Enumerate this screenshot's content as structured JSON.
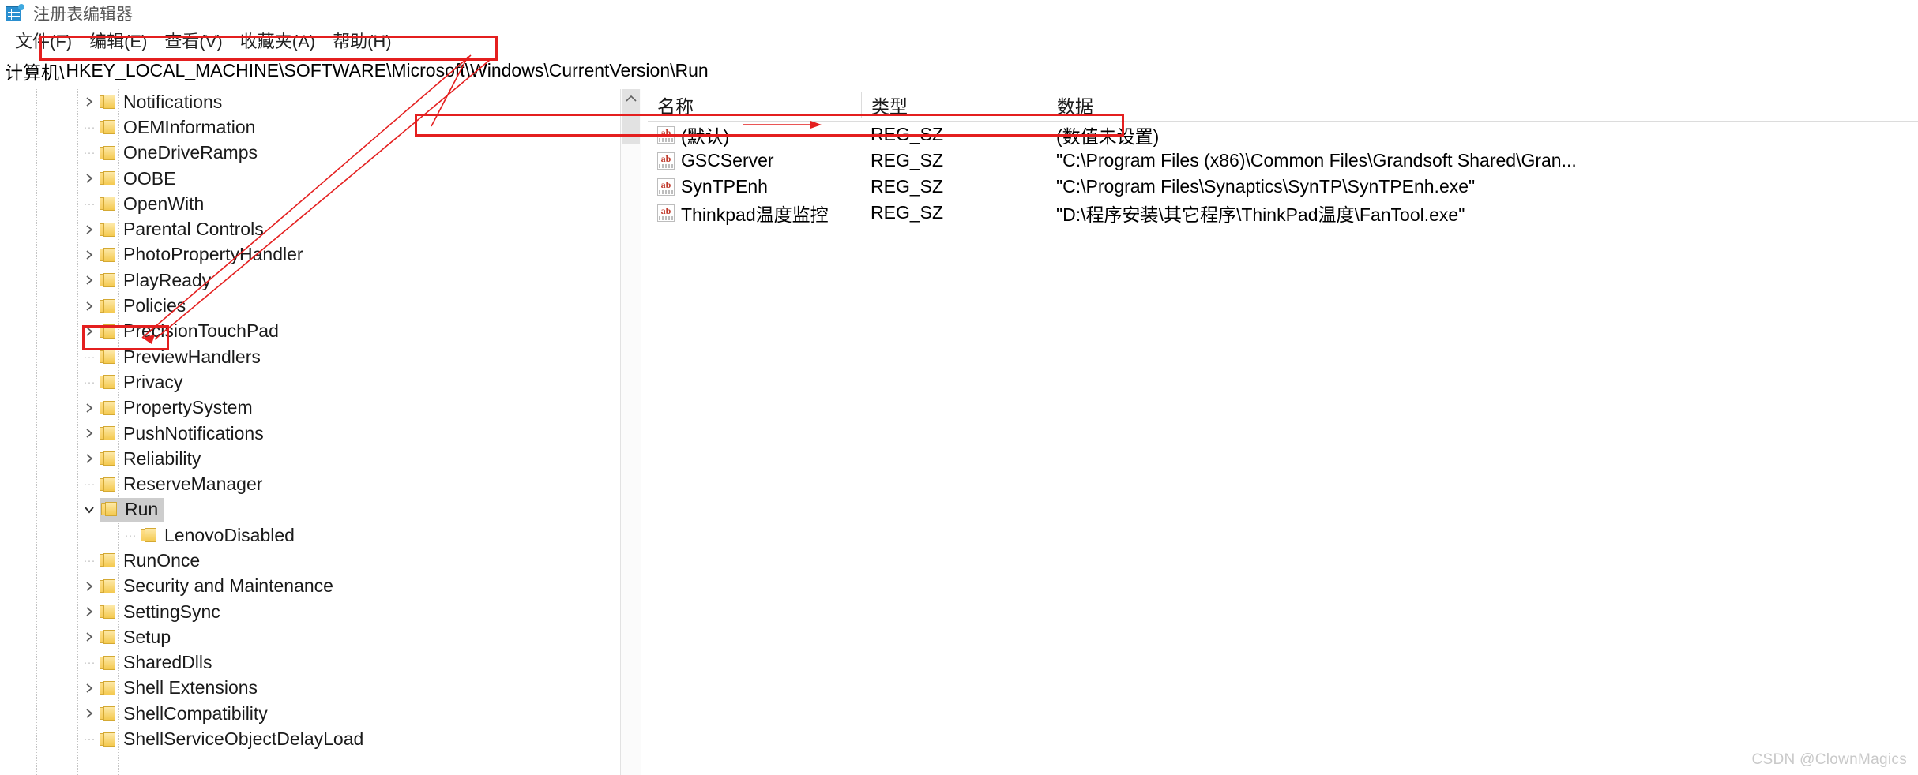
{
  "window": {
    "title": "注册表编辑器",
    "icon": "registry-editor-icon"
  },
  "menu": {
    "items": [
      {
        "label": "文件(F)"
      },
      {
        "label": "编辑(E)"
      },
      {
        "label": "查看(V)"
      },
      {
        "label": "收藏夹(A)"
      },
      {
        "label": "帮助(H)"
      }
    ]
  },
  "address": {
    "prefix": "计算机\\",
    "value": "HKEY_LOCAL_MACHINE\\SOFTWARE\\Microsoft\\Windows\\CurrentVersion\\Run"
  },
  "tree": {
    "scroll_up_icon": "chevron-up-icon",
    "items": [
      {
        "label": "Notifications",
        "depth": 1,
        "expander": "collapsed",
        "selected": false
      },
      {
        "label": "OEMInformation",
        "depth": 1,
        "expander": "leaf",
        "selected": false
      },
      {
        "label": "OneDriveRamps",
        "depth": 1,
        "expander": "leaf",
        "selected": false
      },
      {
        "label": "OOBE",
        "depth": 1,
        "expander": "collapsed",
        "selected": false
      },
      {
        "label": "OpenWith",
        "depth": 1,
        "expander": "leaf",
        "selected": false
      },
      {
        "label": "Parental Controls",
        "depth": 1,
        "expander": "collapsed",
        "selected": false
      },
      {
        "label": "PhotoPropertyHandler",
        "depth": 1,
        "expander": "collapsed",
        "selected": false
      },
      {
        "label": "PlayReady",
        "depth": 1,
        "expander": "collapsed",
        "selected": false
      },
      {
        "label": "Policies",
        "depth": 1,
        "expander": "collapsed",
        "selected": false
      },
      {
        "label": "PrecisionTouchPad",
        "depth": 1,
        "expander": "collapsed",
        "selected": false
      },
      {
        "label": "PreviewHandlers",
        "depth": 1,
        "expander": "leaf",
        "selected": false
      },
      {
        "label": "Privacy",
        "depth": 1,
        "expander": "leaf",
        "selected": false
      },
      {
        "label": "PropertySystem",
        "depth": 1,
        "expander": "collapsed",
        "selected": false
      },
      {
        "label": "PushNotifications",
        "depth": 1,
        "expander": "collapsed",
        "selected": false
      },
      {
        "label": "Reliability",
        "depth": 1,
        "expander": "collapsed",
        "selected": false
      },
      {
        "label": "ReserveManager",
        "depth": 1,
        "expander": "leaf",
        "selected": false
      },
      {
        "label": "Run",
        "depth": 1,
        "expander": "expanded",
        "selected": true
      },
      {
        "label": "LenovoDisabled",
        "depth": 2,
        "expander": "leaf",
        "selected": false
      },
      {
        "label": "RunOnce",
        "depth": 1,
        "expander": "leaf",
        "selected": false
      },
      {
        "label": "Security and Maintenance",
        "depth": 1,
        "expander": "collapsed",
        "selected": false
      },
      {
        "label": "SettingSync",
        "depth": 1,
        "expander": "collapsed",
        "selected": false
      },
      {
        "label": "Setup",
        "depth": 1,
        "expander": "collapsed",
        "selected": false
      },
      {
        "label": "SharedDlls",
        "depth": 1,
        "expander": "leaf",
        "selected": false
      },
      {
        "label": "Shell Extensions",
        "depth": 1,
        "expander": "collapsed",
        "selected": false
      },
      {
        "label": "ShellCompatibility",
        "depth": 1,
        "expander": "collapsed",
        "selected": false
      },
      {
        "label": "ShellServiceObjectDelayLoad",
        "depth": 1,
        "expander": "leaf",
        "selected": false
      }
    ]
  },
  "list": {
    "columns": [
      {
        "key": "name",
        "label": "名称"
      },
      {
        "key": "type",
        "label": "类型"
      },
      {
        "key": "data",
        "label": "数据"
      }
    ],
    "rows": [
      {
        "icon": "string-value-icon",
        "name": "(默认)",
        "type": "REG_SZ",
        "data": "(数值未设置)"
      },
      {
        "icon": "string-value-icon",
        "name": "GSCServer",
        "type": "REG_SZ",
        "data": "\"C:\\Program Files (x86)\\Common Files\\Grandsoft Shared\\Gran..."
      },
      {
        "icon": "string-value-icon",
        "name": "SynTPEnh",
        "type": "REG_SZ",
        "data": "\"C:\\Program Files\\Synaptics\\SynTP\\SynTPEnh.exe\""
      },
      {
        "icon": "string-value-icon",
        "name": "Thinkpad温度监控",
        "type": "REG_SZ",
        "data": "\"D:\\程序安装\\其它程序\\ThinkPad温度\\FanTool.exe\""
      }
    ]
  },
  "annotations": {
    "color": "#e41f1f",
    "boxes": [
      {
        "name": "address-bar-highlight"
      },
      {
        "name": "run-key-highlight"
      },
      {
        "name": "syntpenh-row-highlight"
      }
    ]
  },
  "watermark": {
    "text": "CSDN @ClownMagics"
  }
}
